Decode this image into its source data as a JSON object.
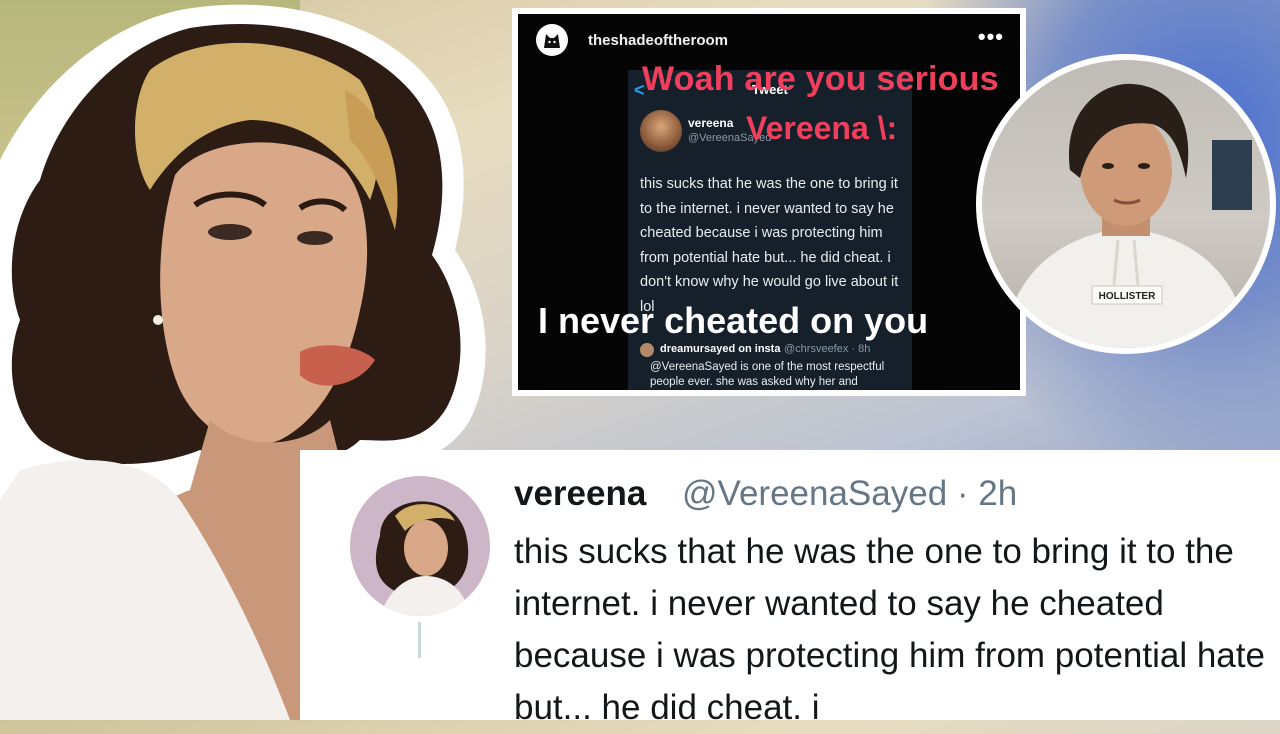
{
  "instagram": {
    "username": "theshadeoftheroom",
    "more_label": "•••"
  },
  "tweet_screenshot": {
    "back": "<",
    "header": "Tweet",
    "name": "vereena",
    "handle": "@VereenaSayed",
    "body": "this sucks that he was the one to bring it to the internet. i never wanted to say he cheated because i was protecting him from potential hate but... he did cheat. i don't know why he would go live about it lol",
    "reply_name": "dreamursayed on insta",
    "reply_handle": "@chrsveefex · 8h",
    "reply_text": "@VereenaSayed is one of the most respectful people ever. she was asked why her and"
  },
  "overlay": {
    "title": "Woah are you serious",
    "subtitle": "Vereena \\:",
    "bottom": "I never cheated on you"
  },
  "boy_hoodie_text": "HOLLISTER",
  "tweet_card": {
    "name": "vereena",
    "handle": "@VereenaSayed · 2h",
    "text": "this sucks that he was the one to bring it to the internet. i never wanted to say he cheated because i was protecting him from potential hate but... he did cheat. i"
  }
}
